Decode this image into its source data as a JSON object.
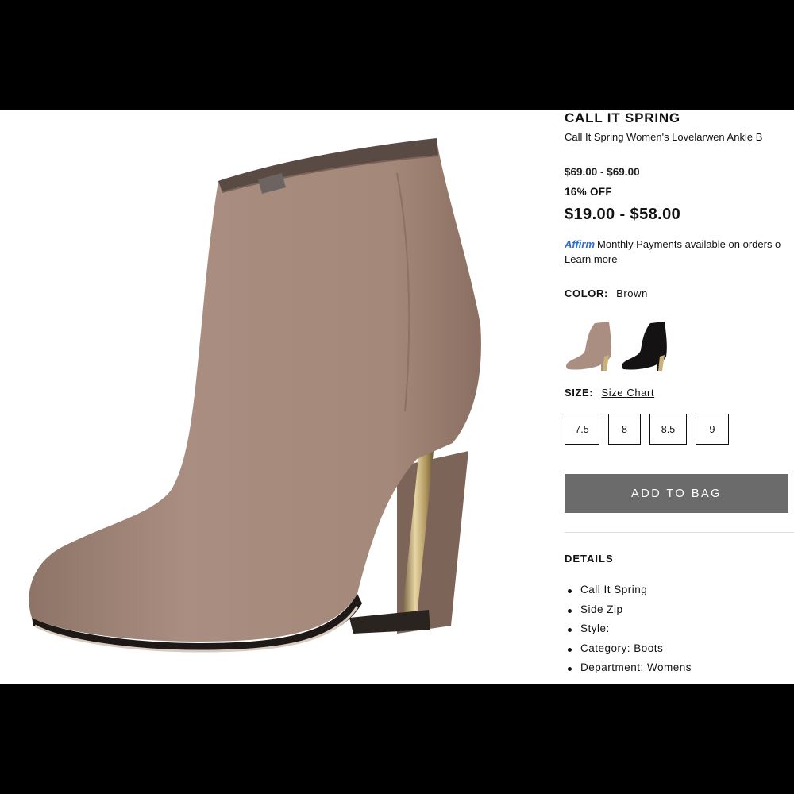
{
  "product": {
    "brand": "CALL IT SPRING",
    "name": "Call It Spring Women's Lovelarwen Ankle B",
    "original_price": "$69.00 - $69.00",
    "discount": "16% OFF",
    "sale_price": "$19.00 - $58.00"
  },
  "affirm": {
    "logo": "Affirm",
    "text": "Monthly Payments available on orders o",
    "learn_more": "Learn more"
  },
  "color": {
    "label": "COLOR:",
    "selected": "Brown",
    "swatches": [
      "brown-boot-swatch",
      "black-boot-swatch"
    ]
  },
  "size": {
    "label": "SIZE:",
    "chart_link": "Size Chart",
    "options": [
      "7.5",
      "8",
      "8.5",
      "9"
    ]
  },
  "actions": {
    "add_to_bag": "ADD TO BAG"
  },
  "details": {
    "title": "DETAILS",
    "items": [
      "Call It Spring",
      "Side Zip",
      "Style:",
      "Category: Boots",
      "Department: Womens"
    ]
  },
  "colors": {
    "boot_taupe": "#a5897c",
    "button_gray": "#6b6b6b",
    "affirm_blue": "#2e6cd3"
  }
}
